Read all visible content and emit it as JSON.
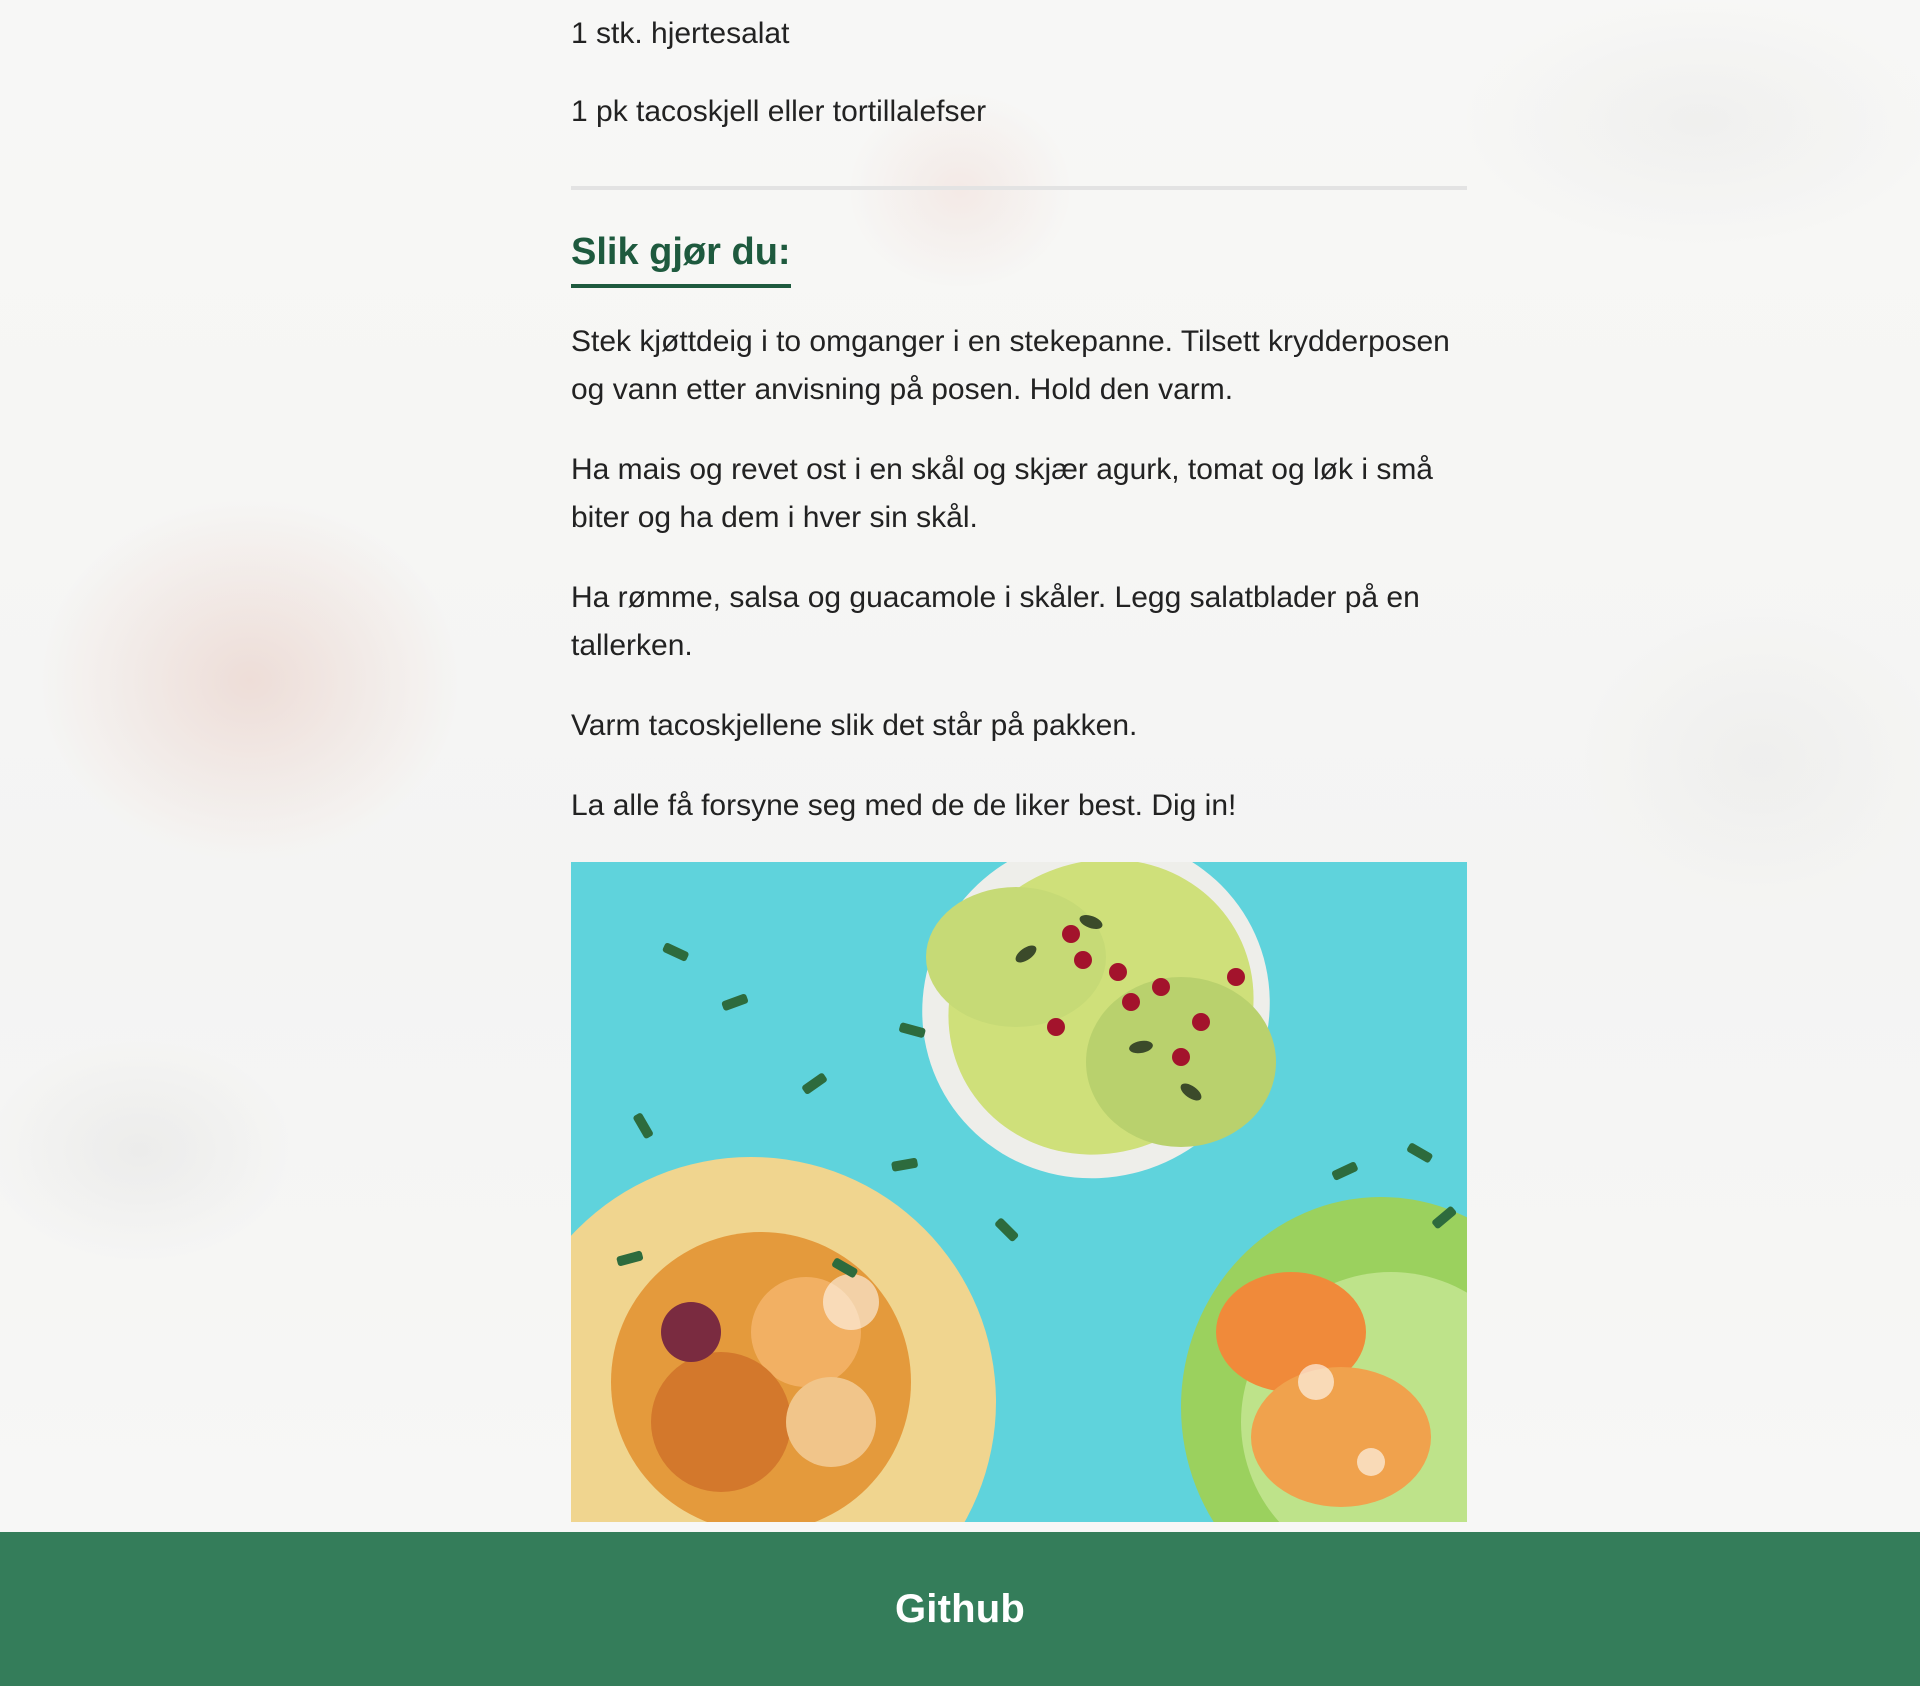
{
  "ingredients": [
    "1 stk. hjertesalat",
    "1 pk tacoskjell eller tortillalefser"
  ],
  "method": {
    "title": "Slik gjør du:",
    "steps": [
      "Stek kjøttdeig i to omganger i en stekepanne. Tilsett krydderposen og vann etter anvisning på posen. Hold den varm.",
      "Ha mais og revet ost i en skål og skjær agurk, tomat og løk i små biter og ha dem i hver sin skål.",
      "Ha rømme, salsa og guacamole i skåler. Legg salatblader på en tallerken.",
      "Varm tacoskjellene slik det står på pakken.",
      "La alle få forsyne seg med de de liker best. Dig in!"
    ]
  },
  "footer": {
    "link_label": "Github"
  },
  "colors": {
    "brand_green": "#347d5a",
    "heading_green": "#1e5a3e",
    "photo_background": "#5fd3dc"
  }
}
